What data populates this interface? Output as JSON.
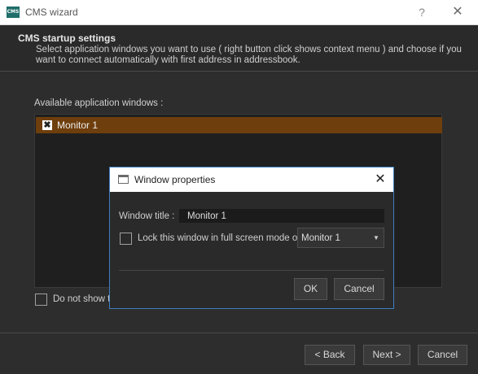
{
  "window": {
    "icon_text": "CMS",
    "title": "CMS wizard",
    "help_glyph": "?",
    "close_glyph": "✕"
  },
  "header": {
    "title": "CMS startup settings",
    "description": "Select application windows you want to use ( right button click shows context menu ) and choose if you want to connect automatically with first address in addressbook."
  },
  "main": {
    "available_label": "Available application windows :",
    "windows": [
      {
        "label": "Monitor 1",
        "checked": true,
        "selected": true
      }
    ],
    "dont_show_label": "Do not show th",
    "dont_show_checked": false
  },
  "footer": {
    "back_label": "< Back",
    "next_label": "Next >",
    "cancel_label": "Cancel"
  },
  "dialog": {
    "title": "Window properties",
    "close_glyph": "✕",
    "window_title_label": "Window title :",
    "window_title_value": "Monitor 1",
    "lock_label": "Lock this window in full screen mode on :",
    "lock_checked": false,
    "monitor_selected": "Monitor 1",
    "ok_label": "OK",
    "cancel_label": "Cancel"
  },
  "colors": {
    "background": "#2d2d2d",
    "selection": "#6e3e0c",
    "dialog_border": "#3c7fc1"
  }
}
